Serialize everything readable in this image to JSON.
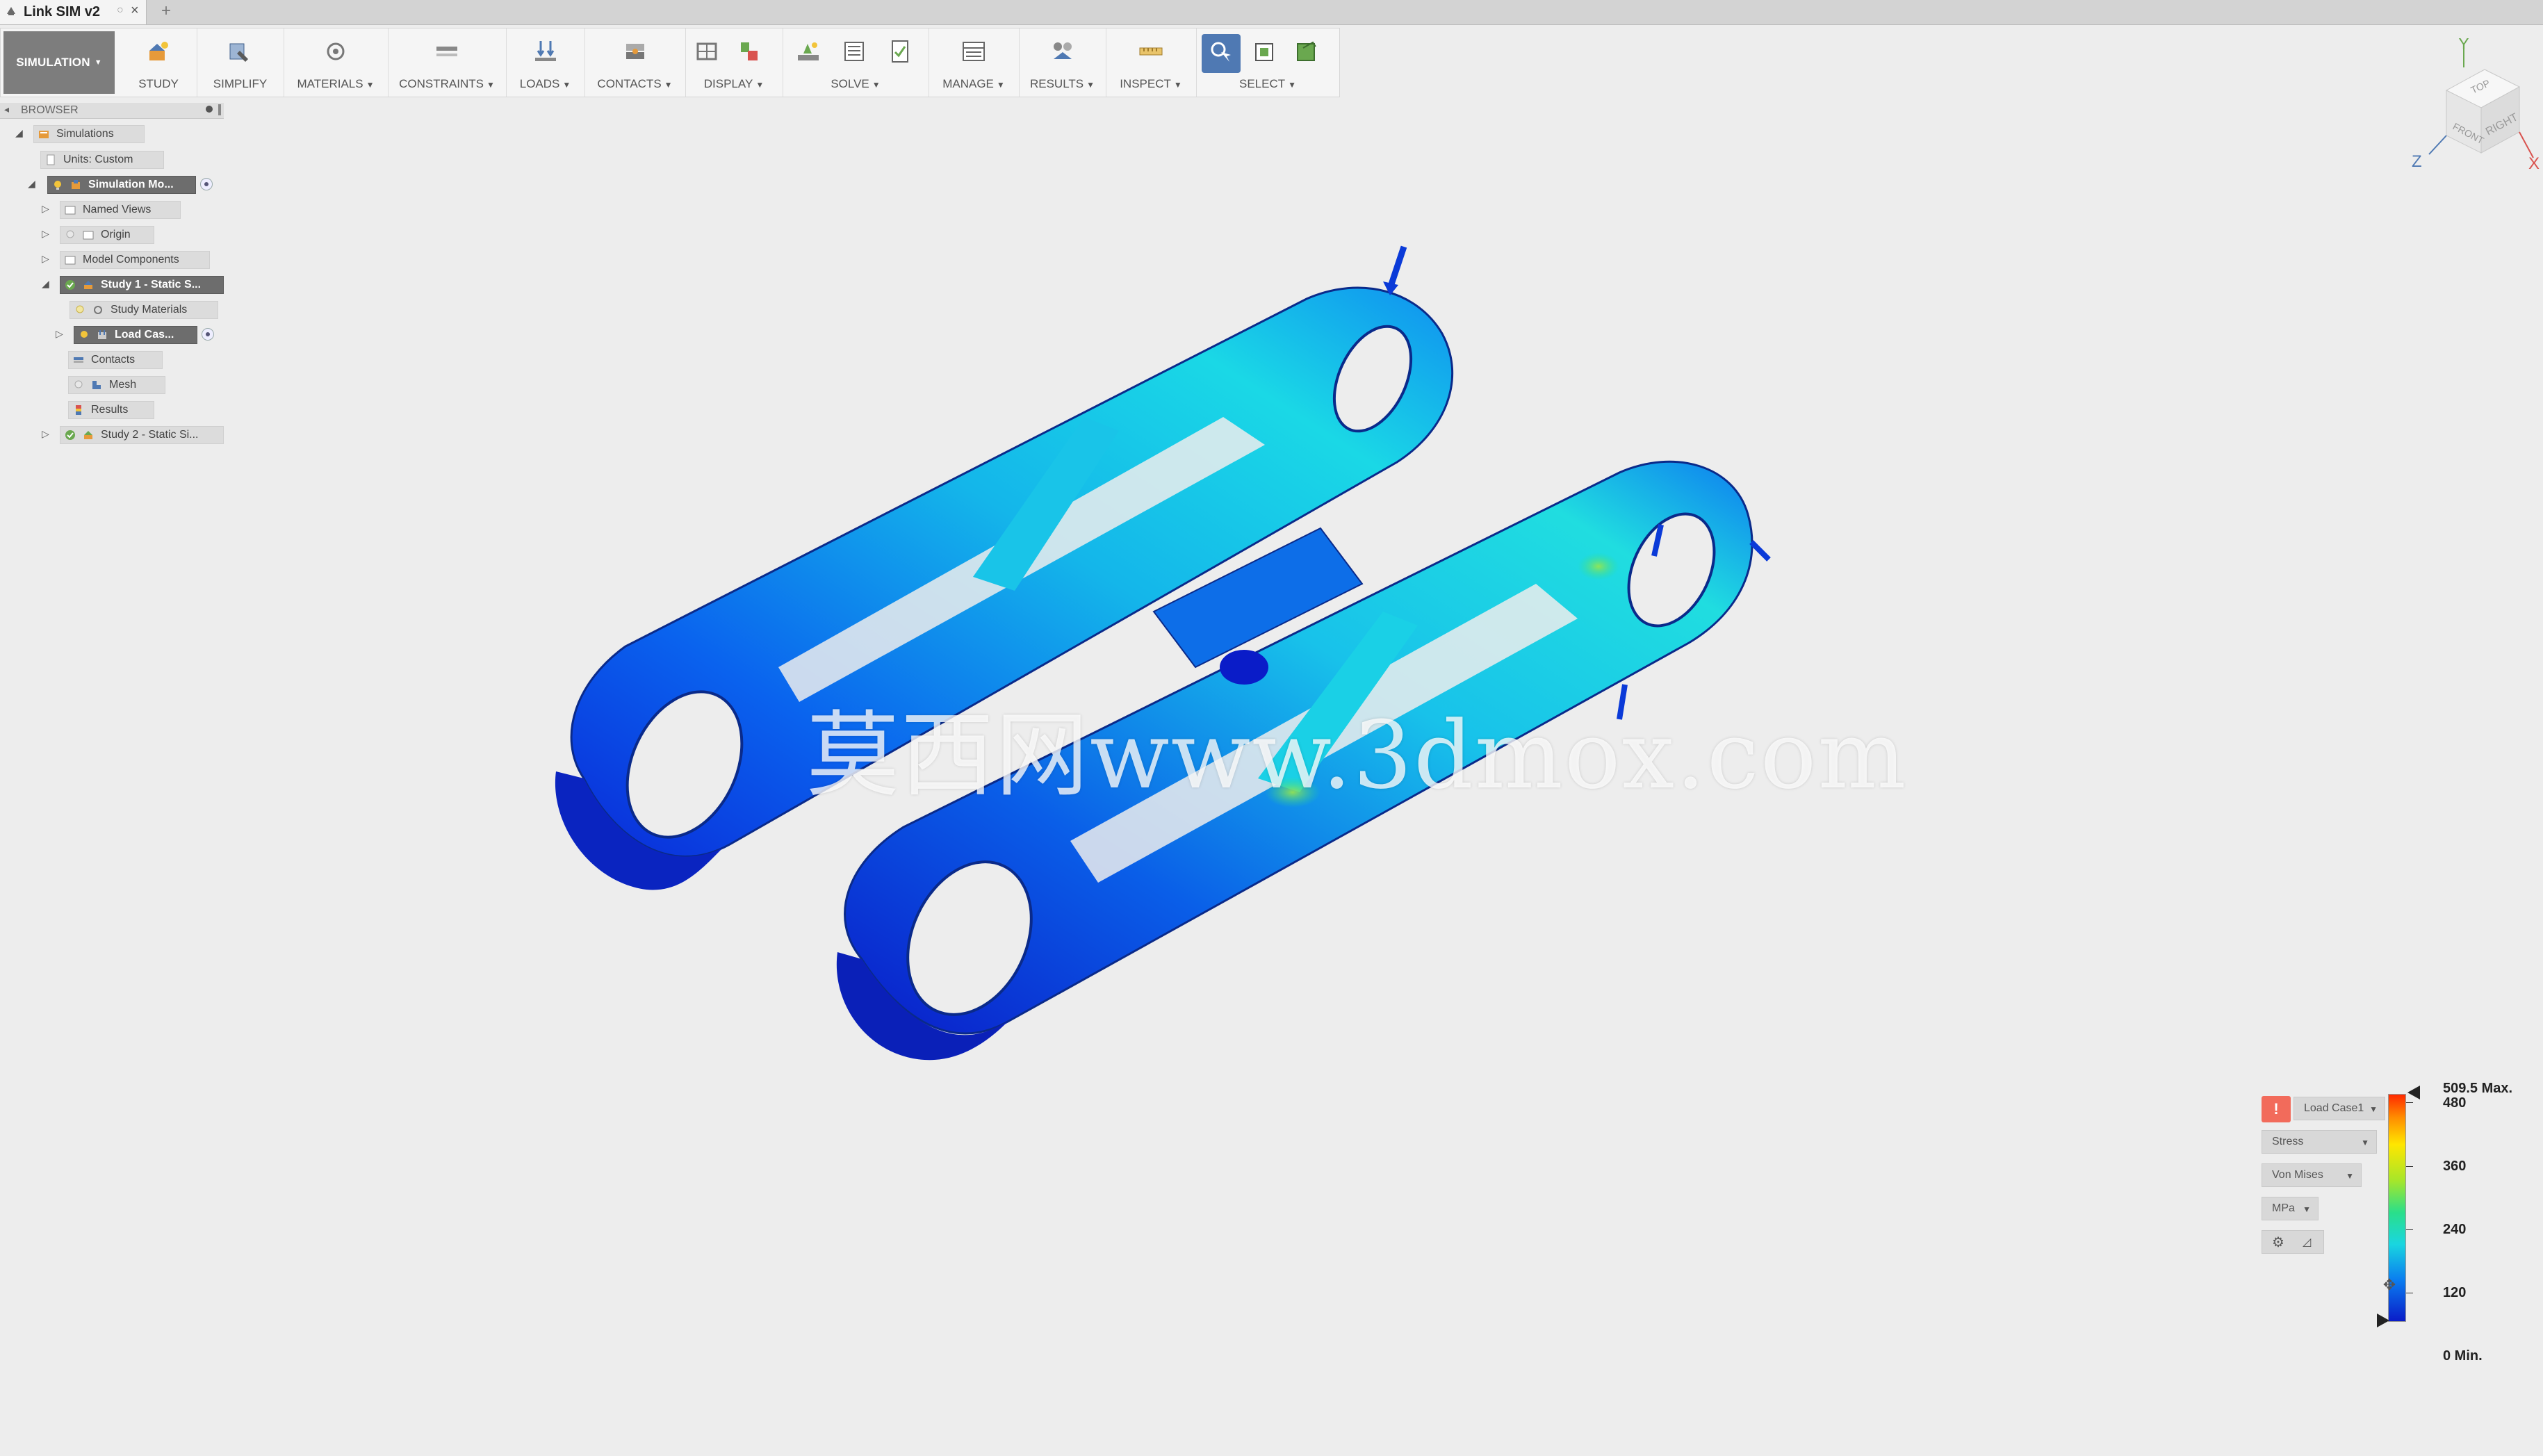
{
  "app": {
    "tab_title": "Link SIM v2",
    "tab_close": "×",
    "new_tab": "+"
  },
  "toolbar": {
    "workspace": "SIMULATION",
    "groups": [
      {
        "label": "STUDY",
        "dropdown": false
      },
      {
        "label": "SIMPLIFY",
        "dropdown": false
      },
      {
        "label": "MATERIALS",
        "dropdown": true
      },
      {
        "label": "CONSTRAINTS",
        "dropdown": true
      },
      {
        "label": "LOADS",
        "dropdown": true
      },
      {
        "label": "CONTACTS",
        "dropdown": true
      },
      {
        "label": "DISPLAY",
        "dropdown": true
      },
      {
        "label": "SOLVE",
        "dropdown": true
      },
      {
        "label": "MANAGE",
        "dropdown": true
      },
      {
        "label": "RESULTS",
        "dropdown": true
      },
      {
        "label": "INSPECT",
        "dropdown": true
      },
      {
        "label": "SELECT",
        "dropdown": true
      }
    ]
  },
  "browser": {
    "title": "BROWSER",
    "nodes": [
      {
        "label": "Simulations"
      },
      {
        "label": "Units: Custom"
      },
      {
        "label": "Simulation Mo..."
      },
      {
        "label": "Named Views"
      },
      {
        "label": "Origin"
      },
      {
        "label": "Model Components"
      },
      {
        "label": "Study 1 - Static S..."
      },
      {
        "label": "Study Materials"
      },
      {
        "label": "Load Cas..."
      },
      {
        "label": "Contacts"
      },
      {
        "label": "Mesh"
      },
      {
        "label": "Results"
      },
      {
        "label": "Study 2 - Static Si..."
      }
    ]
  },
  "viewcube": {
    "top": "TOP",
    "front": "FRONT",
    "right": "RIGHT",
    "axis_x": "X",
    "axis_y": "Y",
    "axis_z": "Z"
  },
  "watermark": "莫西网www.3dmox.com",
  "legend": {
    "warning": "!",
    "load_case": "Load Case1",
    "result_type": "Stress",
    "component": "Von Mises",
    "unit": "MPa",
    "ticks": [
      "509.5 Max.",
      "480",
      "360",
      "240",
      "120",
      "0 Min."
    ],
    "colors": {
      "max": "#ff2a00",
      "min": "#0a1cc8"
    }
  }
}
